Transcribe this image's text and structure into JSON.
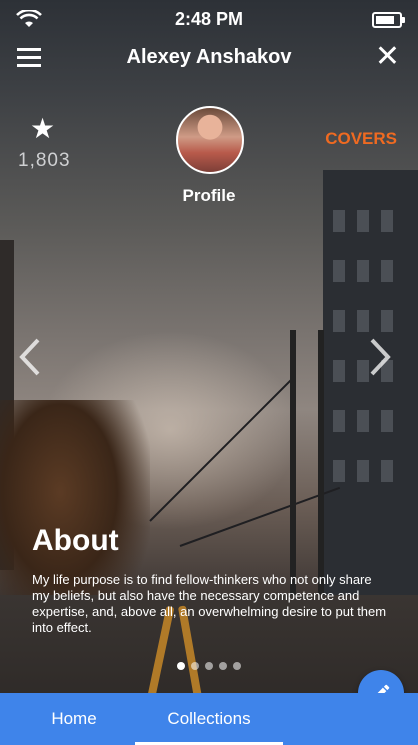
{
  "statusbar": {
    "time": "2:48 PM",
    "battery_level": 0.7
  },
  "header": {
    "title": "Alexey Anshakov"
  },
  "stats": {
    "star_count": "1,803"
  },
  "profile": {
    "label": "Profile"
  },
  "covers_label": "COVERS",
  "about": {
    "heading": "About",
    "text": "My life purpose is to find fellow-thinkers who not only share my beliefs, but also have the necessary competence and expertise, and, above all, an overwhelming desire to put them into effect."
  },
  "pagination": {
    "total": 5,
    "active_index": 0
  },
  "bottom_nav": {
    "tabs": [
      {
        "label": "Home"
      },
      {
        "label": "Collections"
      }
    ],
    "active_index": 1
  },
  "colors": {
    "accent": "#3f84ea",
    "covers": "#ef6a21"
  },
  "icons": [
    "wifi-icon",
    "battery-icon",
    "menu-icon",
    "close-icon",
    "star-icon",
    "chevron-left-icon",
    "chevron-right-icon",
    "pencil-icon"
  ]
}
